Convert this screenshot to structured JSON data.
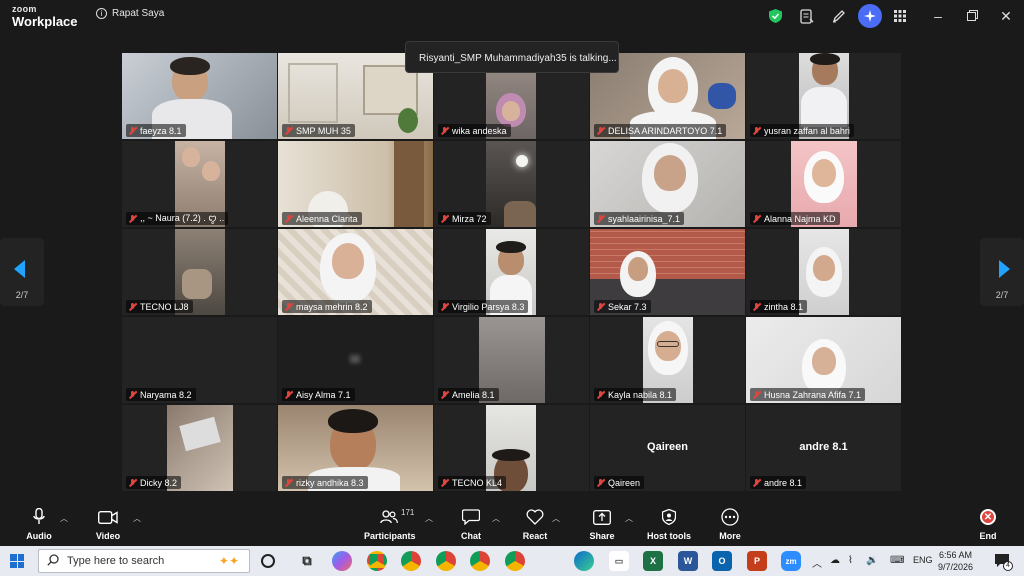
{
  "window": {
    "brand_top": "zoom",
    "brand_bottom": "Workplace",
    "meeting_title": "Rapat Saya"
  },
  "talking_banner": "Risyanti_SMP Muhammadiyah35 is talking...",
  "pagination": {
    "left": "2/7",
    "right": "2/7"
  },
  "participants": [
    {
      "name": "faeyza 8.1"
    },
    {
      "name": "SMP MUH 35"
    },
    {
      "name": "wika andeska"
    },
    {
      "name": "DELISA ARINDARTOYO 7.1"
    },
    {
      "name": "yusran zaffan al bahri"
    },
    {
      "name": ",, ~ Naura (7.2)  .  ꨄ︎ .."
    },
    {
      "name": "Aleenna Clarita"
    },
    {
      "name": "Mirza 72"
    },
    {
      "name": "syahlaairinisa_7.1"
    },
    {
      "name": "Alanna Najma KD"
    },
    {
      "name": "TECNO LJ8"
    },
    {
      "name": "maysa mehrin 8.2"
    },
    {
      "name": "Virgilio Parsya 8.3"
    },
    {
      "name": "Sekar 7.3"
    },
    {
      "name": "zintha 8.1"
    },
    {
      "name": "Naryama 8.2"
    },
    {
      "name": "Aisy Alma 7.1"
    },
    {
      "name": "Amelia 8.1"
    },
    {
      "name": "Kayla nabila 8.1"
    },
    {
      "name": "Husna Zahrana Afifa 7.1"
    },
    {
      "name": "Dicky 8.2"
    },
    {
      "name": "rizky andhika 8.3"
    },
    {
      "name": "TECNO KL4"
    },
    {
      "name": "Qaireen",
      "display_name": "Qaireen"
    },
    {
      "name": "andre 8.1",
      "display_name": "andre 8.1"
    }
  ],
  "toolbar": {
    "audio": "Audio",
    "video": "Video",
    "participants": "Participants",
    "participants_count": "171",
    "chat": "Chat",
    "react": "React",
    "share": "Share",
    "host_tools": "Host tools",
    "more": "More",
    "end": "End"
  },
  "taskbar": {
    "search_placeholder": "Type here to search",
    "lang": "ENG",
    "time": "6:56 AM",
    "date": "9/7/2026",
    "notifications": "4"
  },
  "colors": {
    "accent": "#1fa3ff",
    "mute_red": "#e0443e",
    "end_red": "#e0443e",
    "ai_blue": "#4a6cf7",
    "shield_green": "#22c55e"
  }
}
